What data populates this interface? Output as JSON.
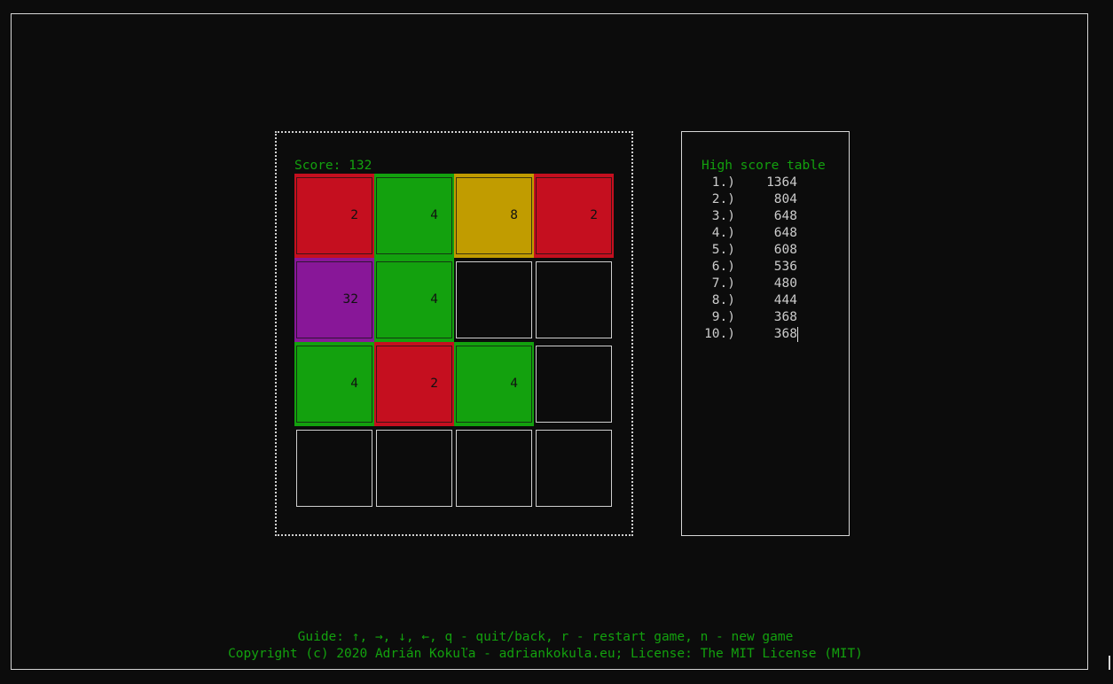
{
  "score_label": "Score: 132",
  "board": {
    "tiles": [
      {
        "row": 0,
        "col": 0,
        "value": "2",
        "color": "#c50f1f"
      },
      {
        "row": 0,
        "col": 1,
        "value": "4",
        "color": "#13a10e"
      },
      {
        "row": 0,
        "col": 2,
        "value": "8",
        "color": "#c19c00"
      },
      {
        "row": 0,
        "col": 3,
        "value": "2",
        "color": "#c50f1f"
      },
      {
        "row": 1,
        "col": 0,
        "value": "32",
        "color": "#881798"
      },
      {
        "row": 1,
        "col": 1,
        "value": "4",
        "color": "#13a10e"
      },
      {
        "row": 1,
        "col": 2,
        "value": "",
        "color": ""
      },
      {
        "row": 1,
        "col": 3,
        "value": "",
        "color": ""
      },
      {
        "row": 2,
        "col": 0,
        "value": "4",
        "color": "#13a10e"
      },
      {
        "row": 2,
        "col": 1,
        "value": "2",
        "color": "#c50f1f"
      },
      {
        "row": 2,
        "col": 2,
        "value": "4",
        "color": "#13a10e"
      },
      {
        "row": 2,
        "col": 3,
        "value": "",
        "color": ""
      },
      {
        "row": 3,
        "col": 0,
        "value": "",
        "color": ""
      },
      {
        "row": 3,
        "col": 1,
        "value": "",
        "color": ""
      },
      {
        "row": 3,
        "col": 2,
        "value": "",
        "color": ""
      },
      {
        "row": 3,
        "col": 3,
        "value": "",
        "color": ""
      }
    ]
  },
  "high_scores": {
    "title": "High score table",
    "entries": [
      {
        "rank": "1.)",
        "score": "1364"
      },
      {
        "rank": "2.)",
        "score": "804"
      },
      {
        "rank": "3.)",
        "score": "648"
      },
      {
        "rank": "4.)",
        "score": "648"
      },
      {
        "rank": "5.)",
        "score": "608"
      },
      {
        "rank": "6.)",
        "score": "536"
      },
      {
        "rank": "7.)",
        "score": "480"
      },
      {
        "rank": "8.)",
        "score": "444"
      },
      {
        "rank": "9.)",
        "score": "368"
      },
      {
        "rank": "10.)",
        "score": "368"
      }
    ]
  },
  "footer": {
    "guide": "Guide: ↑, →, ↓, ←, q - quit/back, r - restart game, n - new game",
    "copyright": "Copyright (c) 2020 Adrián Kokuľa - adriankokula.eu; License: The MIT License (MIT)"
  }
}
